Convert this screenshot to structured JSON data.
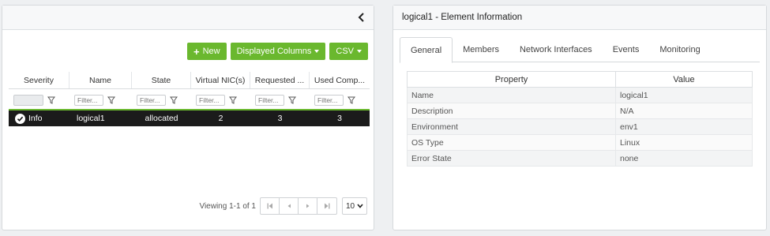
{
  "left": {
    "toolbar": {
      "new_label": "New",
      "columns_label": "Displayed Columns",
      "csv_label": "CSV"
    },
    "columns": [
      "Severity",
      "Name",
      "State",
      "Virtual NIC(s)",
      "Requested ...",
      "Used Comp..."
    ],
    "filter_placeholder": "Filter...",
    "rows": [
      {
        "severity": "Info",
        "name": "logical1",
        "state": "allocated",
        "vnics": "2",
        "requested": "3",
        "used": "3"
      }
    ],
    "pager": {
      "viewing": "Viewing 1-1 of 1",
      "page_size": "10"
    }
  },
  "right": {
    "title": "logical1 - Element Information",
    "tabs": [
      "General",
      "Members",
      "Network Interfaces",
      "Events",
      "Monitoring"
    ],
    "active_tab": "General",
    "table_headers": {
      "property": "Property",
      "value": "Value"
    },
    "properties": [
      {
        "key": "Name",
        "value": "logical1"
      },
      {
        "key": "Description",
        "value": "N/A"
      },
      {
        "key": "Environment",
        "value": "env1"
      },
      {
        "key": "OS Type",
        "value": "Linux"
      },
      {
        "key": "Error State",
        "value": "none"
      }
    ]
  },
  "colors": {
    "accent": "#6ab82e",
    "selected_row": "#1b1b1b"
  }
}
